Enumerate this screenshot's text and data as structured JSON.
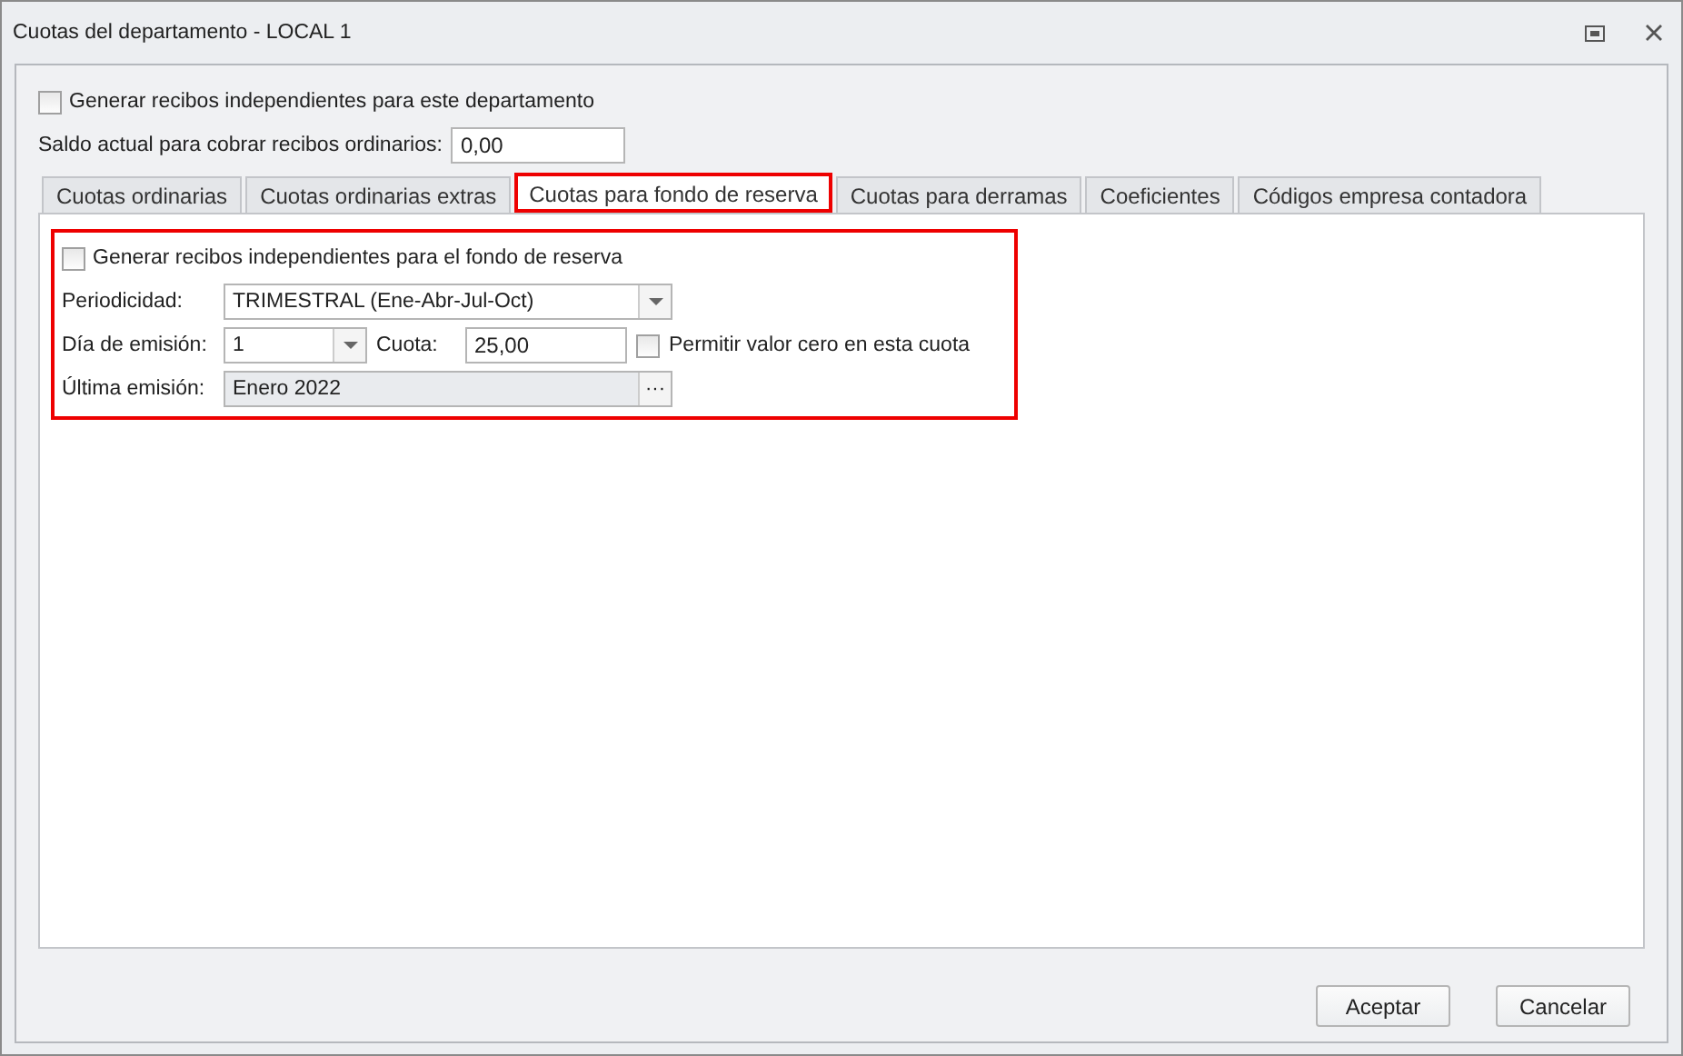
{
  "window": {
    "title": "Cuotas del departamento - LOCAL 1"
  },
  "generate_independent": {
    "label": "Generar recibos independientes para este departamento",
    "checked": false
  },
  "balance": {
    "label": "Saldo actual para cobrar recibos ordinarios:",
    "value": "0,00"
  },
  "tabs": [
    {
      "label": "Cuotas ordinarias",
      "selected": false,
      "highlighted": false
    },
    {
      "label": "Cuotas ordinarias extras",
      "selected": false,
      "highlighted": false
    },
    {
      "label": "Cuotas para fondo de reserva",
      "selected": true,
      "highlighted": true
    },
    {
      "label": "Cuotas para derramas",
      "selected": false,
      "highlighted": false
    },
    {
      "label": "Coeficientes",
      "selected": false,
      "highlighted": false
    },
    {
      "label": "Códigos empresa contadora",
      "selected": false,
      "highlighted": false
    }
  ],
  "reserve_group": {
    "highlighted": true,
    "generate_independent": {
      "label": "Generar recibos independientes para el fondo de reserva",
      "checked": false
    },
    "periodicity": {
      "label": "Periodicidad:",
      "value": "TRIMESTRAL (Ene-Abr-Jul-Oct)"
    },
    "issue_day": {
      "label": "Día de emisión:",
      "value": "1"
    },
    "fee": {
      "label": "Cuota:",
      "value": "25,00"
    },
    "allow_zero": {
      "label": "Permitir valor cero en esta cuota",
      "checked": false
    },
    "last_issue": {
      "label": "Última emisión:",
      "value": "Enero 2022",
      "button": "···"
    }
  },
  "buttons": [
    "Aceptar",
    "Cancelar"
  ]
}
